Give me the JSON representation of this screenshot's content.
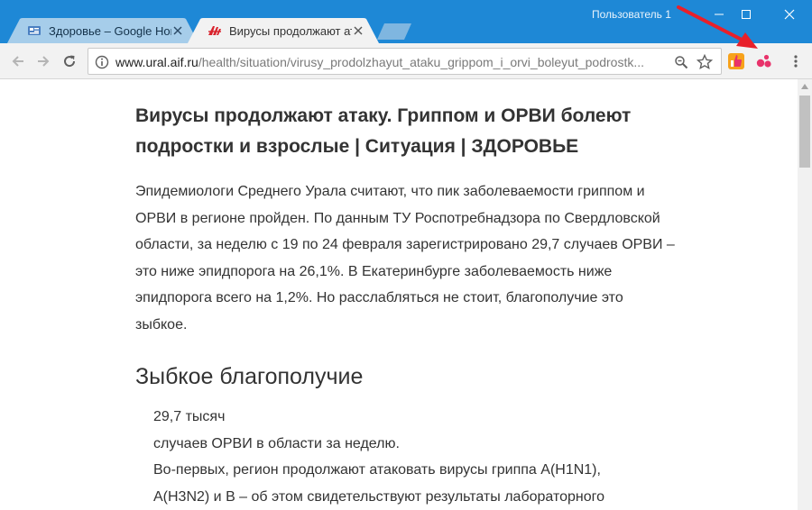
{
  "window": {
    "user_label": "Пользователь 1"
  },
  "tabs": [
    {
      "title": "Здоровье – Google Нов",
      "favicon": "google-news-icon",
      "active": false
    },
    {
      "title": "Вирусы продолжают ата",
      "favicon": "aif-icon",
      "active": true
    }
  ],
  "toolbar": {
    "url_host": "www.ural.aif.ru",
    "url_path": "/health/situation/virusy_prodolzhayut_ataku_grippom_i_orvi_boleyut_podrostk..."
  },
  "article": {
    "title": "Вирусы продолжают атаку. Гриппом и ОРВИ болеют подростки и взрослые | Ситуация | ЗДОРОВЬЕ",
    "lead": "Эпидемиологи Среднего Урала считают, что пик заболеваемости гриппом и ОРВИ в регионе пройден. По данным ТУ Роспотребнадзора по Свердловской области, за неделю с 19 по 24 февраля зарегистрировано 29,7 случаев ОРВИ – это ниже эпидпорога на 26,1%. В Екатеринбурге заболеваемость ниже эпидпорога всего на 1,2%. Но расслабляться не стоит, благополучие это зыбкое.",
    "subheading": "Зыбкое благополучие",
    "body_lines": [
      "29,7 тысяч",
      "случаев ОРВИ в области за неделю.",
      "Во-первых, регион продолжают атаковать вирусы гриппа А(H1N1),",
      "А(H3N2) и В – об этом свидетельствуют результаты лабораторного"
    ]
  },
  "colors": {
    "titlebar": "#1e88d6",
    "annotation_arrow": "#e8202a",
    "extension_dots": "#e8336b"
  }
}
